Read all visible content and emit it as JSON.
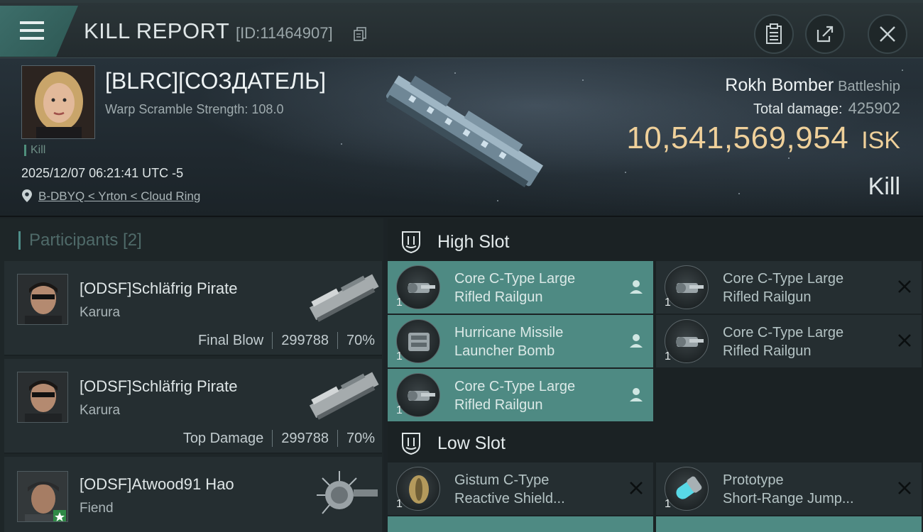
{
  "header": {
    "title": "KILL REPORT",
    "report_id": "[ID:11464907]"
  },
  "victim": {
    "name": "[BLRC][СОЗДАТЕЛЬ]",
    "warp_scramble": "Warp Scramble Strength: 108.0",
    "tag": "Kill",
    "datetime": "2025/12/07 06:21:41 UTC -5",
    "location": "B-DBYQ < Yrton < Cloud Ring",
    "ship_name": "Rokh Bomber",
    "ship_class": "Battleship",
    "total_damage_label": "Total damage:",
    "total_damage": "425902",
    "isk_value": "10,541,569,954",
    "isk_unit": "ISK",
    "result": "Kill"
  },
  "participants": {
    "header": "Participants [2]",
    "items": [
      {
        "name": "[ODSF]Schläfrig Pirate",
        "ship": "Karura",
        "role": "Final Blow",
        "damage": "299788",
        "percent": "70%"
      },
      {
        "name": "[ODSF]Schläfrig Pirate",
        "ship": "Karura",
        "role": "Top Damage",
        "damage": "299788",
        "percent": "70%"
      },
      {
        "name": "[ODSF]Atwood91 Hao",
        "ship": "Fiend",
        "role": "",
        "damage": "",
        "percent": ""
      }
    ]
  },
  "fitting": {
    "high_slot": {
      "label": "High Slot",
      "modules": [
        {
          "name_line1": "Core C-Type Large",
          "name_line2": "Rifled Railgun",
          "qty": "1",
          "status": "pilot",
          "icon": "railgun-icon"
        },
        {
          "name_line1": "Core C-Type Large",
          "name_line2": "Rifled Railgun",
          "qty": "1",
          "status": "destroyed",
          "icon": "railgun-icon"
        },
        {
          "name_line1": "Hurricane Missile",
          "name_line2": "Launcher Bomb",
          "qty": "1",
          "status": "pilot",
          "icon": "missile-launcher-icon"
        },
        {
          "name_line1": "Core C-Type Large",
          "name_line2": "Rifled Railgun",
          "qty": "1",
          "status": "destroyed",
          "icon": "railgun-icon"
        },
        {
          "name_line1": "Core C-Type Large",
          "name_line2": "Rifled Railgun",
          "qty": "1",
          "status": "pilot",
          "icon": "railgun-icon"
        }
      ]
    },
    "low_slot": {
      "label": "Low Slot",
      "modules": [
        {
          "name_line1": "Gistum C-Type",
          "name_line2": "Reactive Shield...",
          "qty": "1",
          "status": "destroyed",
          "icon": "shield-hardener-icon"
        },
        {
          "name_line1": "Prototype",
          "name_line2": "Short-Range Jump...",
          "qty": "1",
          "status": "destroyed",
          "icon": "jump-drive-icon"
        }
      ]
    }
  },
  "colors": {
    "accent_teal": "#4e8a83",
    "isk_gold": "#efd09a",
    "panel": "#252e31"
  }
}
